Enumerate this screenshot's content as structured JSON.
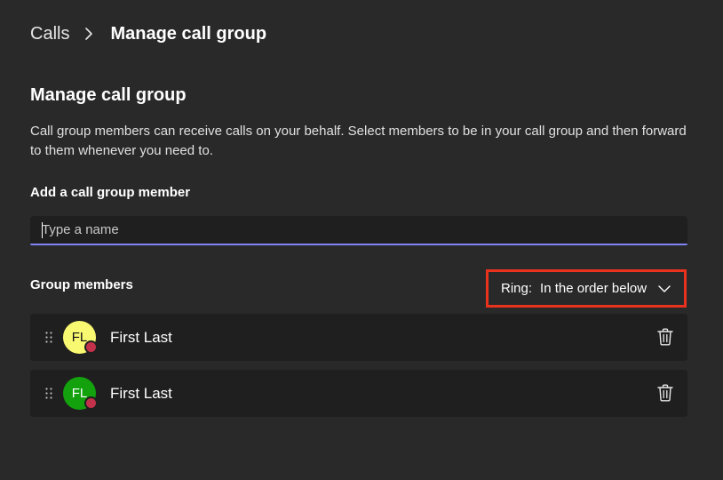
{
  "breadcrumb": {
    "parent": "Calls",
    "current": "Manage call group"
  },
  "section": {
    "title": "Manage call group",
    "description": "Call group members can receive calls on your behalf. Select members to be in your call group and then forward to them whenever you need to."
  },
  "add_member": {
    "label": "Add a call group member",
    "placeholder": "Type a name",
    "value": ""
  },
  "group": {
    "label": "Group members",
    "ring": {
      "prefix": "Ring:",
      "value": "In the order below"
    },
    "members": [
      {
        "initials": "FL",
        "name": "First Last",
        "avatar_color": "#f9f871",
        "presence_color": "#c4314b"
      },
      {
        "initials": "FL",
        "name": "First Last",
        "avatar_color": "#13a10e",
        "presence_color": "#c4314b"
      }
    ]
  },
  "colors": {
    "background": "#292929",
    "row_background": "#1f1f1f",
    "input_accent": "#7f85f5",
    "highlight_border": "#e8321d"
  }
}
